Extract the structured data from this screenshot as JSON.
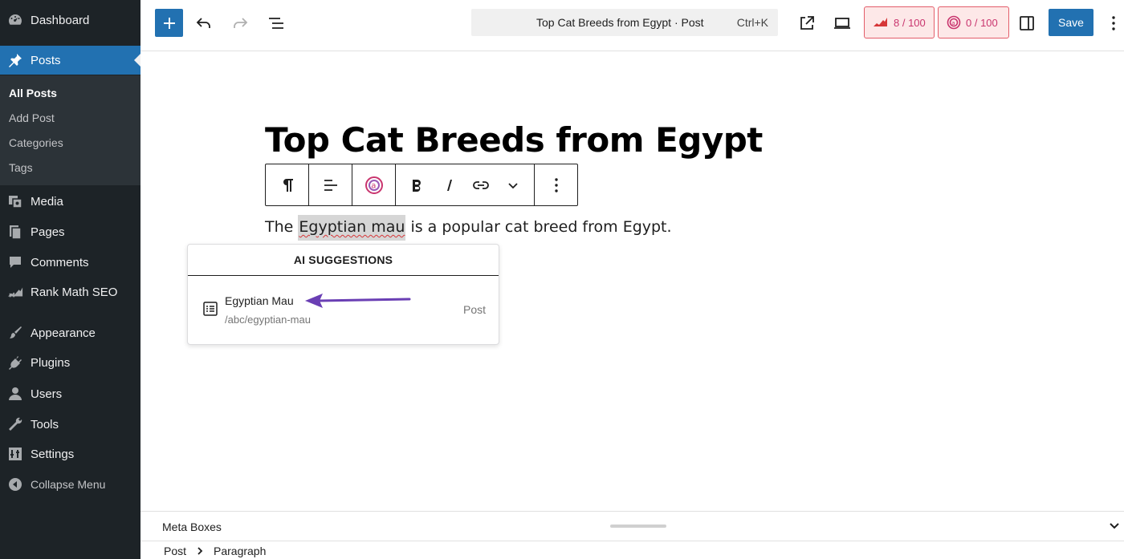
{
  "sidebar": {
    "menu": [
      {
        "label": "Dashboard",
        "icon": "dashboard-icon"
      },
      {
        "label": "Posts",
        "icon": "pin-icon",
        "active": true
      },
      {
        "label": "Media",
        "icon": "media-icon"
      },
      {
        "label": "Pages",
        "icon": "pages-icon"
      },
      {
        "label": "Comments",
        "icon": "comment-icon"
      },
      {
        "label": "Rank Math SEO",
        "icon": "chart-icon"
      },
      {
        "label": "Appearance",
        "icon": "brush-icon"
      },
      {
        "label": "Plugins",
        "icon": "plugin-icon"
      },
      {
        "label": "Users",
        "icon": "user-icon"
      },
      {
        "label": "Tools",
        "icon": "wrench-icon"
      },
      {
        "label": "Settings",
        "icon": "settings-icon"
      }
    ],
    "submenu": [
      "All Posts",
      "Add Post",
      "Categories",
      "Tags"
    ],
    "collapse_label": "Collapse Menu"
  },
  "topbar": {
    "command_title": "Top Cat Breeds from Egypt · Post",
    "command_shortcut": "Ctrl+K",
    "seo_score": "8 / 100",
    "content_ai_score": "0 / 100",
    "save_label": "Save"
  },
  "editor": {
    "title": "Top Cat Breeds from Egypt",
    "paragraph_before": "The ",
    "paragraph_highlight": "Egyptian mau",
    "paragraph_after": " is a popular cat breed from Egypt."
  },
  "suggestions": {
    "header": "AI SUGGESTIONS",
    "items": [
      {
        "title": "Egyptian Mau",
        "url": "/abc/egyptian-mau",
        "type": "Post"
      }
    ]
  },
  "bottom": {
    "meta_boxes_label": "Meta Boxes",
    "breadcrumb": [
      "Post",
      "Paragraph"
    ]
  },
  "colors": {
    "sidebar_bg": "#1d2327",
    "accent": "#2271b1",
    "score_red": "#c9356e",
    "arrow_purple": "#6a3fb4"
  }
}
